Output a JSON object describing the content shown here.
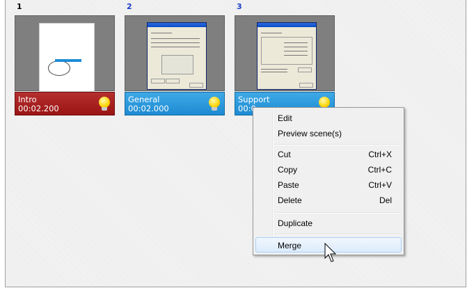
{
  "scenes": [
    {
      "number": "1",
      "name": "Intro",
      "time": "00:02.200"
    },
    {
      "number": "2",
      "name": "General",
      "time": "00:02.000"
    },
    {
      "number": "3",
      "name": "Support",
      "time": "00:0_.___"
    }
  ],
  "context_menu": {
    "items": [
      {
        "label": "Edit",
        "shortcut": ""
      },
      {
        "label": "Preview scene(s)",
        "shortcut": ""
      },
      {
        "label": "Cut",
        "shortcut": "Ctrl+X"
      },
      {
        "label": "Copy",
        "shortcut": "Ctrl+C"
      },
      {
        "label": "Paste",
        "shortcut": "Ctrl+V"
      },
      {
        "label": "Delete",
        "shortcut": "Del"
      },
      {
        "label": "Duplicate",
        "shortcut": ""
      },
      {
        "label": "Merge",
        "shortcut": ""
      }
    ],
    "highlighted": "Merge"
  },
  "colors": {
    "caption_red": "#a51b1b",
    "caption_blue": "#2a9ae0",
    "menu_highlight": "#dcebfc"
  },
  "icons": [
    "lightbulb-icon",
    "mouse-pointer-icon"
  ]
}
